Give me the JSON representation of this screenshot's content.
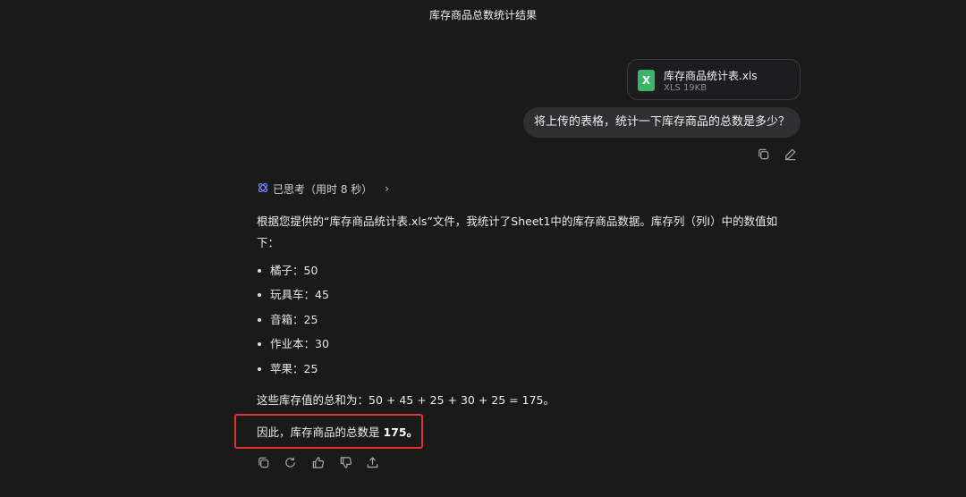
{
  "title": "库存商品总数统计结果",
  "attachment": {
    "name": "库存商品统计表.xls",
    "meta": "XLS 19KB",
    "icon_letter": "X",
    "icon_color": "#3bb468"
  },
  "user_message": "将上传的表格，统计一下库存商品的总数是多少？",
  "user_actions": {
    "copy_icon": "copy-icon",
    "edit_icon": "edit-icon"
  },
  "thinking": {
    "label": "已思考（用时 8 秒）",
    "icon": "thinking-icon"
  },
  "answer": {
    "intro": "根据您提供的“库存商品统计表.xls”文件，我统计了Sheet1中的库存商品数据。库存列（列I）中的数值如下：",
    "items": [
      "橘子：50",
      "玩具车：45",
      "音箱：25",
      "作业本：30",
      "苹果：25"
    ],
    "sum_line": "这些库存值的总和为：50 + 45 + 25 + 30 + 25 = 175。",
    "final_prefix": "因此，库存商品的总数是 ",
    "final_value": "175",
    "final_suffix": "。"
  },
  "highlight_color": "#e0322e",
  "answer_actions": [
    "copy-icon",
    "regenerate-icon",
    "thumbs-up-icon",
    "thumbs-down-icon",
    "share-icon"
  ]
}
